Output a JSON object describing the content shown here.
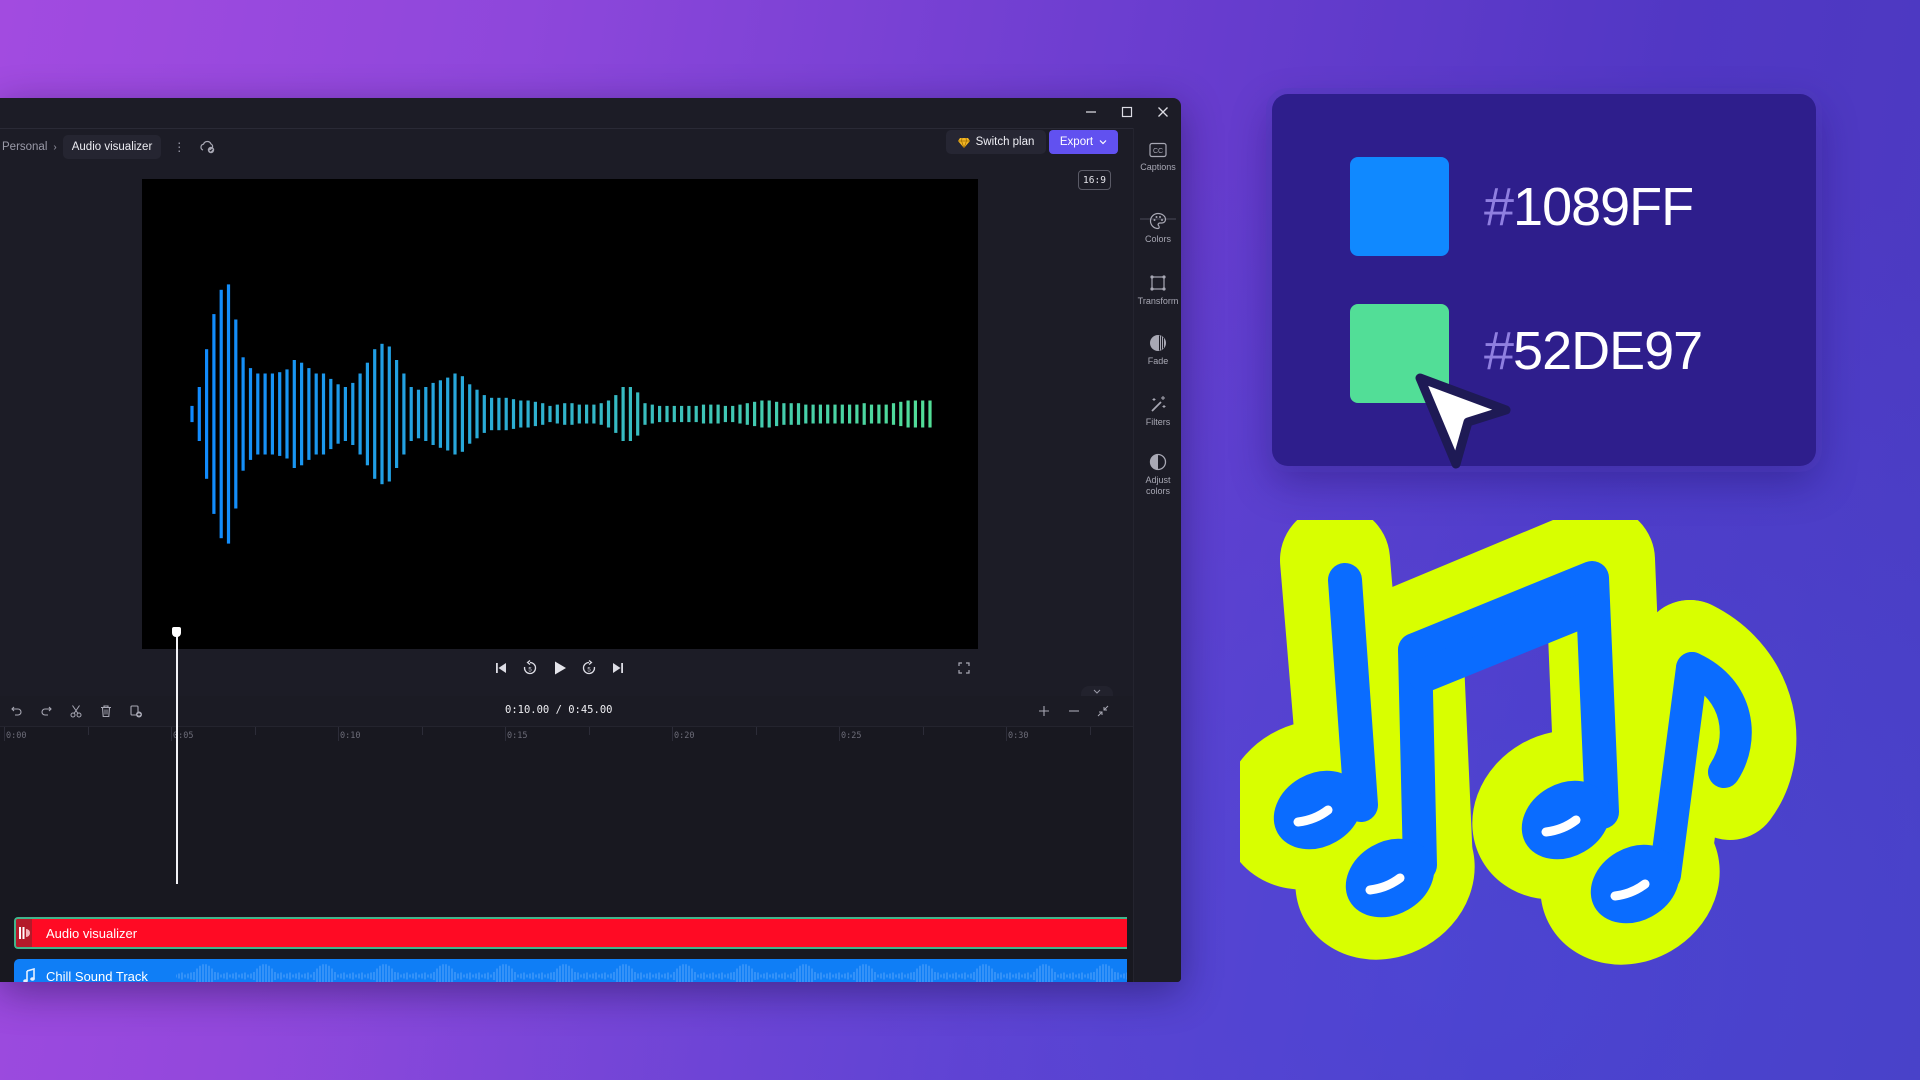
{
  "window": {
    "controls": {
      "minimize": "—",
      "maximize": "☐",
      "close": "✕"
    },
    "breadcrumb": {
      "root": "Personal",
      "separator": "›",
      "current": "Audio visualizer"
    },
    "more_icon": "⋮",
    "cloud_icon": "cloud-sync-icon"
  },
  "header": {
    "switch_plan_label": "Switch plan",
    "export_label": "Export",
    "aspect_ratio": "16:9"
  },
  "side_panel": {
    "items": [
      {
        "label": "Captions",
        "icon": "captions-icon"
      },
      {
        "label": "Colors",
        "icon": "palette-icon"
      },
      {
        "label": "Transform",
        "icon": "transform-icon"
      },
      {
        "label": "Fade",
        "icon": "fade-icon"
      },
      {
        "label": "Filters",
        "icon": "magic-wand-icon"
      },
      {
        "label": "Adjust colors",
        "icon": "adjust-colors-icon"
      }
    ]
  },
  "preview": {
    "visualizer_colors": {
      "start": "#1089FF",
      "end": "#52DE97"
    },
    "bar_levels": [
      0.06,
      0.2,
      0.48,
      0.74,
      0.92,
      0.96,
      0.7,
      0.42,
      0.34,
      0.3,
      0.3,
      0.3,
      0.31,
      0.33,
      0.4,
      0.38,
      0.34,
      0.3,
      0.3,
      0.26,
      0.22,
      0.2,
      0.23,
      0.3,
      0.38,
      0.48,
      0.52,
      0.5,
      0.4,
      0.3,
      0.2,
      0.18,
      0.2,
      0.23,
      0.25,
      0.27,
      0.3,
      0.28,
      0.22,
      0.18,
      0.14,
      0.12,
      0.12,
      0.12,
      0.11,
      0.1,
      0.1,
      0.09,
      0.08,
      0.06,
      0.07,
      0.08,
      0.08,
      0.07,
      0.07,
      0.07,
      0.08,
      0.1,
      0.14,
      0.2,
      0.2,
      0.16,
      0.08,
      0.07,
      0.06,
      0.06,
      0.06,
      0.06,
      0.06,
      0.06,
      0.07,
      0.07,
      0.07,
      0.06,
      0.06,
      0.07,
      0.08,
      0.09,
      0.1,
      0.1,
      0.09,
      0.08,
      0.08,
      0.08,
      0.07,
      0.07,
      0.07,
      0.07,
      0.07,
      0.07,
      0.07,
      0.07,
      0.08,
      0.07,
      0.07,
      0.07,
      0.08,
      0.09,
      0.1,
      0.1,
      0.1,
      0.1
    ]
  },
  "playback": {
    "skip_back": "skip-to-start-icon",
    "rewind_5": "rewind-5-icon",
    "play": "play-icon",
    "forward_5": "forward-5-icon",
    "skip_forward": "skip-to-end-icon",
    "fullscreen": "fullscreen-icon"
  },
  "timeline": {
    "current_time": "0:10.00",
    "total_time": "0:45.00",
    "timecode": "0:10.00 / 0:45.00",
    "ruler_labels": [
      "0:00",
      "0:05",
      "0:10",
      "0:15",
      "0:20",
      "0:25",
      "0:30"
    ],
    "playhead_seconds": 5,
    "tracks": [
      {
        "label": "Audio visualizer",
        "color": "#FF0A24",
        "type": "visualizer"
      },
      {
        "label": "Chill Sound Track",
        "color": "#0F7EF6",
        "type": "audio"
      }
    ]
  },
  "color_card": {
    "swatches": [
      {
        "hex": "#1089FF",
        "hash": "#",
        "code": "1089FF"
      },
      {
        "hex": "#52DE97",
        "hash": "#",
        "code": "52DE97"
      }
    ]
  },
  "decor": {
    "music_notes_colors": {
      "outline": "#D8FF00",
      "fill": "#0A6CFF"
    }
  }
}
